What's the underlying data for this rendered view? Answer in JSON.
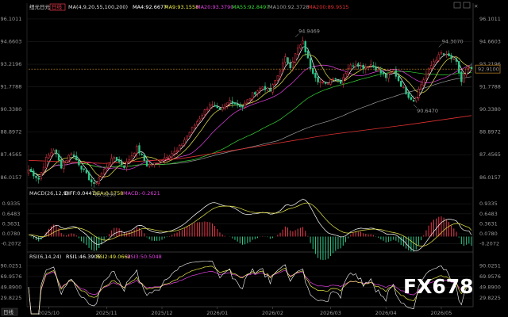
{
  "header": {
    "symbol": "纽元日元",
    "period": "日线",
    "ma_params": "MA(4,9,20,55,100,200)",
    "ma4": "MA4:92.6677",
    "ma9": "MA9:93.1558",
    "ma20": "MA20:93.3790",
    "ma55": "MA55:92.8497",
    "ma100": "MA100:92.3728",
    "ma200": "MA200:89.9515"
  },
  "macd_header": {
    "params": "MACD(26,12,9)",
    "diff": "DIFF:0.0447",
    "dea": "DEA:0.1758",
    "macd": "MACD:-0.2621"
  },
  "rsi_header": {
    "params": "RSI(6,14,24)",
    "rsi1": "RSI1:46.3905",
    "rsi2": "RSI2:49.0662",
    "rsi3": "RSI3:50.5048"
  },
  "price_axis": [
    "96.1011",
    "94.6603",
    "93.2196",
    "91.7788",
    "90.3380",
    "88.8972",
    "87.4565",
    "86.0157"
  ],
  "macd_axis": [
    "0.9335",
    "0.6483",
    "0.3631",
    "0.0780",
    "-0.2072"
  ],
  "rsi_axis": [
    "90.0251",
    "69.9576",
    "49.8900",
    "29.8225"
  ],
  "current_price": "92.9100",
  "annotations": {
    "high1": "94.9469",
    "high2": "94.3070",
    "low1": "85.3290",
    "low2": "90.6470"
  },
  "x_ticks": [
    "2025/10",
    "2025/11",
    "2025/12",
    "2026/01",
    "2026/02",
    "2026/03",
    "2026/04",
    "2026/05"
  ],
  "watermark": "FX678",
  "colors": {
    "up": "#e8394a",
    "down": "#2ec88a",
    "ma4": "#ffffff",
    "ma9": "#e8e84a",
    "ma20": "#e040e0",
    "ma55": "#36d636",
    "ma100": "#9a9a9a",
    "ma200": "#e03030",
    "dea": "#e8e84a",
    "diff": "#ffffff"
  },
  "chart_data": {
    "type": "candlestick",
    "ylim": [
      85.6,
      96.4
    ],
    "x_ticks": [
      "2025/10",
      "2025/11",
      "2025/12",
      "2026/01",
      "2026/02",
      "2026/03",
      "2026/04",
      "2026/05"
    ],
    "pivots": [
      {
        "t": 0,
        "v": 86.5
      },
      {
        "t": 4,
        "v": 85.9
      },
      {
        "t": 7,
        "v": 87.2
      },
      {
        "t": 10,
        "v": 87.8
      },
      {
        "t": 13,
        "v": 86.7
      },
      {
        "t": 17,
        "v": 87.6
      },
      {
        "t": 22,
        "v": 86.4
      },
      {
        "t": 26,
        "v": 85.5
      },
      {
        "t": 30,
        "v": 86.5
      },
      {
        "t": 34,
        "v": 87.3
      },
      {
        "t": 38,
        "v": 86.7
      },
      {
        "t": 43,
        "v": 87.9
      },
      {
        "t": 47,
        "v": 86.8
      },
      {
        "t": 51,
        "v": 86.9
      },
      {
        "t": 55,
        "v": 87.4
      },
      {
        "t": 59,
        "v": 87.7
      },
      {
        "t": 64,
        "v": 88.9
      },
      {
        "t": 68,
        "v": 89.8
      },
      {
        "t": 72,
        "v": 90.7
      },
      {
        "t": 76,
        "v": 90.2
      },
      {
        "t": 80,
        "v": 90.9
      },
      {
        "t": 85,
        "v": 90.5
      },
      {
        "t": 89,
        "v": 91.3
      },
      {
        "t": 93,
        "v": 91.8
      },
      {
        "t": 96,
        "v": 91.5
      },
      {
        "t": 99,
        "v": 92.5
      },
      {
        "t": 102,
        "v": 93.6
      },
      {
        "t": 104,
        "v": 93.1
      },
      {
        "t": 107,
        "v": 94.2
      },
      {
        "t": 109,
        "v": 94.6
      },
      {
        "t": 112,
        "v": 93.0
      },
      {
        "t": 115,
        "v": 92.2
      },
      {
        "t": 118,
        "v": 91.9
      },
      {
        "t": 121,
        "v": 92.4
      },
      {
        "t": 124,
        "v": 92.1
      },
      {
        "t": 127,
        "v": 93.0
      },
      {
        "t": 130,
        "v": 93.3
      },
      {
        "t": 133,
        "v": 93.0
      },
      {
        "t": 136,
        "v": 93.2
      },
      {
        "t": 139,
        "v": 92.8
      },
      {
        "t": 142,
        "v": 92.4
      },
      {
        "t": 145,
        "v": 92.8
      },
      {
        "t": 148,
        "v": 91.9
      },
      {
        "t": 151,
        "v": 91.2
      },
      {
        "t": 153,
        "v": 90.9
      },
      {
        "t": 155,
        "v": 91.6
      },
      {
        "t": 158,
        "v": 92.6
      },
      {
        "t": 161,
        "v": 93.4
      },
      {
        "t": 164,
        "v": 93.9
      },
      {
        "t": 167,
        "v": 93.7
      },
      {
        "t": 170,
        "v": 93.3
      },
      {
        "t": 172,
        "v": 92.1
      },
      {
        "t": 174,
        "v": 92.9
      },
      {
        "t": 176,
        "v": 92.91
      }
    ],
    "ma200_points": [
      [
        0,
        87.1
      ],
      [
        30,
        86.9
      ],
      [
        60,
        87.2
      ],
      [
        90,
        87.95
      ],
      [
        120,
        88.75
      ],
      [
        150,
        89.35
      ],
      [
        176,
        89.95
      ]
    ],
    "annotations": [
      {
        "label": "94.9469",
        "t": 106,
        "v": 94.95
      },
      {
        "label": "94.3070",
        "t": 163,
        "v": 94.31
      },
      {
        "label": "85.3290",
        "t": 25,
        "v": 85.33
      },
      {
        "label": "90.6470",
        "t": 153,
        "v": 90.65
      }
    ],
    "macd": {
      "diff": 0.0447,
      "dea": 0.1758,
      "macd": -0.2621,
      "ylim": [
        -0.35,
        1.05
      ]
    },
    "rsi": {
      "rsi1": 46.3905,
      "rsi2": 49.0662,
      "rsi3": 50.5048,
      "ylim": [
        18,
        98
      ]
    }
  }
}
